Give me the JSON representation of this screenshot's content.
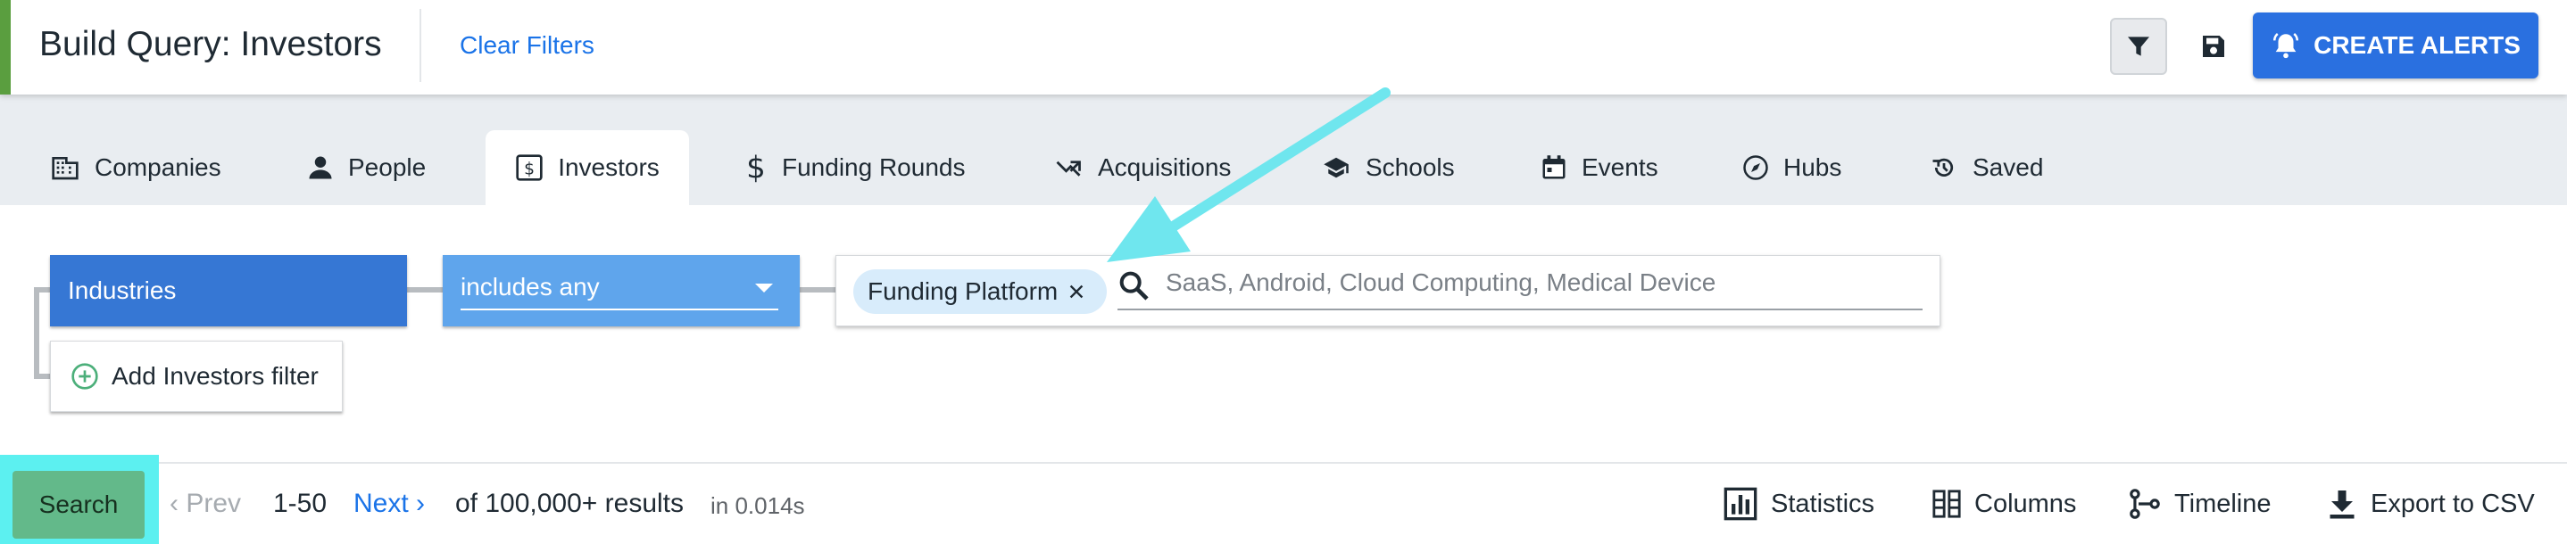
{
  "header": {
    "title": "Build Query: Investors",
    "clear_filters_label": "Clear Filters",
    "create_alerts_label": "CREATE ALERTS"
  },
  "tabs": [
    {
      "label": "Companies",
      "icon": "building-icon",
      "active": false
    },
    {
      "label": "People",
      "icon": "person-icon",
      "active": false
    },
    {
      "label": "Investors",
      "icon": "dollar-box-icon",
      "active": true
    },
    {
      "label": "Funding Rounds",
      "icon": "dollar-icon",
      "active": false
    },
    {
      "label": "Acquisitions",
      "icon": "merge-arrow-icon",
      "active": false
    },
    {
      "label": "Schools",
      "icon": "graduation-cap-icon",
      "active": false
    },
    {
      "label": "Events",
      "icon": "calendar-icon",
      "active": false
    },
    {
      "label": "Hubs",
      "icon": "compass-icon",
      "active": false
    },
    {
      "label": "Saved",
      "icon": "history-icon",
      "active": false
    }
  ],
  "filter": {
    "field_label": "Industries",
    "operator_label": "includes any",
    "chips": [
      "Funding Platform"
    ],
    "search_placeholder": "SaaS, Android, Cloud Computing, Medical Device",
    "add_filter_label": "Add Investors filter"
  },
  "results": {
    "search_label": "Search",
    "prev_label": "Prev",
    "range": "1-50",
    "next_label": "Next",
    "total": "of 100,000+ results",
    "timing": "in 0.014s"
  },
  "actions": [
    {
      "label": "Statistics",
      "icon": "bar-chart-icon"
    },
    {
      "label": "Columns",
      "icon": "columns-icon"
    },
    {
      "label": "Timeline",
      "icon": "timeline-icon"
    },
    {
      "label": "Export to CSV",
      "icon": "download-icon"
    }
  ],
  "colors": {
    "accent_blue": "#2a70e0",
    "industries_blue": "#3677d4",
    "operator_blue": "#5fa5ec",
    "search_green": "#63b98a",
    "highlight_cyan": "#5cf0f0",
    "annotation_arrow": "#6fe6ee",
    "header_accent_green": "#5a9e3f"
  }
}
